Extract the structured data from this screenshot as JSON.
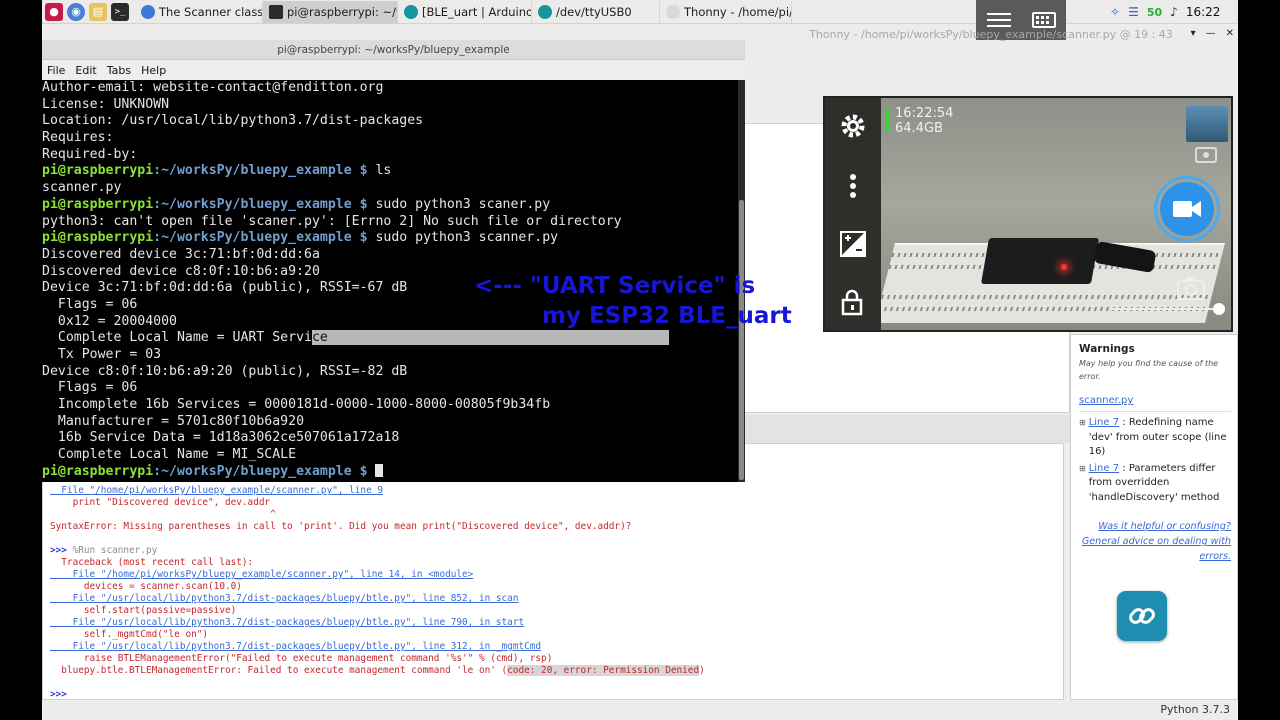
{
  "taskbar": {
    "tasks": [
      {
        "label": "The Scanner class —",
        "icon": "chromium-icon",
        "active": false
      },
      {
        "label": "pi@raspberrypi: ~/wo...",
        "icon": "terminal-icon",
        "active": true
      },
      {
        "label": "[BLE_uart | Arduino 1...",
        "icon": "arduino-icon",
        "active": false
      },
      {
        "label": "/dev/ttyUSB0",
        "icon": "arduino-icon",
        "active": false
      },
      {
        "label": "Thonny  -  /home/pi/...",
        "icon": "thonny-icon",
        "active": false
      }
    ],
    "tray": {
      "battery_level": "50",
      "clock": "16:22"
    }
  },
  "thonny": {
    "title": "Thonny  -  /home/pi/worksPy/bluepy_example/scanner.py  @  19 : 43",
    "status": "Python 3.7.3",
    "warnings": {
      "title": "Warnings",
      "subtitle": "May help you find the cause of the error.",
      "file": "scanner.py",
      "items": [
        {
          "link": "Line 7",
          "text": ": Redefining name 'dev' from outer scope (line 16)"
        },
        {
          "link": "Line 7",
          "text": ": Parameters differ from overridden 'handleDiscovery' method"
        }
      ],
      "footer_1": "Was it helpful or confusing?",
      "footer_2": "General advice on dealing with errors."
    },
    "shell": [
      {
        "type": "link",
        "text": "  File \"/home/pi/worksPy/bluepy_example/scanner.py\", line 9"
      },
      {
        "type": "err",
        "text": "    print \"Discovered device\", dev.addr"
      },
      {
        "type": "err",
        "text": "                                       ^"
      },
      {
        "type": "err",
        "text": "SyntaxError: Missing parentheses in call to 'print'. Did you mean print(\"Discovered device\", dev.addr)?"
      },
      {
        "type": "blank",
        "text": ""
      },
      {
        "type": "prompt",
        "prompt": ">>>",
        "text": " %Run scanner.py"
      },
      {
        "type": "err",
        "text": "  Traceback (most recent call last):"
      },
      {
        "type": "link",
        "text": "    File \"/home/pi/worksPy/bluepy_example/scanner.py\", line 14, in <module>"
      },
      {
        "type": "err",
        "text": "      devices = scanner.scan(10.0)"
      },
      {
        "type": "link",
        "text": "    File \"/usr/local/lib/python3.7/dist-packages/bluepy/btle.py\", line 852, in scan"
      },
      {
        "type": "err",
        "text": "      self.start(passive=passive)"
      },
      {
        "type": "link",
        "text": "    File \"/usr/local/lib/python3.7/dist-packages/bluepy/btle.py\", line 790, in start"
      },
      {
        "type": "err",
        "text": "      self._mgmtCmd(\"le on\")"
      },
      {
        "type": "link",
        "text": "    File \"/usr/local/lib/python3.7/dist-packages/bluepy/btle.py\", line 312, in _mgmtCmd"
      },
      {
        "type": "err",
        "text": "      raise BTLEManagementError(\"Failed to execute management command '%s'\" % (cmd), rsp)"
      },
      {
        "type": "errhl",
        "text": "  bluepy.btle.BTLEManagementError: Failed to execute management command 'le on' (",
        "hl": "code: 20, error: Permission Denied",
        "tail": ")"
      },
      {
        "type": "blank",
        "text": ""
      },
      {
        "type": "prompt",
        "prompt": ">>>",
        "text": ""
      }
    ]
  },
  "terminal": {
    "title": "pi@raspberrypi: ~/worksPy/bluepy_example",
    "menu": [
      "File",
      "Edit",
      "Tabs",
      "Help"
    ],
    "prompt_user": "pi@raspberrypi",
    "prompt_path": ":~/worksPy/bluepy_example $",
    "lines": [
      {
        "type": "out",
        "text": "Author-email: website-contact@fenditton.org"
      },
      {
        "type": "out",
        "text": "License: UNKNOWN"
      },
      {
        "type": "out",
        "text": "Location: /usr/local/lib/python3.7/dist-packages"
      },
      {
        "type": "out",
        "text": "Requires:"
      },
      {
        "type": "out",
        "text": "Required-by:"
      },
      {
        "type": "cmd",
        "text": " ls"
      },
      {
        "type": "out",
        "text": "scanner.py"
      },
      {
        "type": "cmd",
        "text": " sudo python3 scaner.py"
      },
      {
        "type": "out",
        "text": "python3: can't open file 'scaner.py': [Errno 2] No such file or directory"
      },
      {
        "type": "cmd",
        "text": " sudo python3 scanner.py"
      },
      {
        "type": "out",
        "text": "Discovered device 3c:71:bf:0d:dd:6a"
      },
      {
        "type": "out",
        "text": "Discovered device c8:0f:10:b6:a9:20"
      },
      {
        "type": "out",
        "text": "Device 3c:71:bf:0d:dd:6a (public), RSSI=-67 dB"
      },
      {
        "type": "out",
        "text": "  Flags = 06"
      },
      {
        "type": "out",
        "text": "  0x12 = 20004000"
      },
      {
        "type": "sel",
        "text": "  Complete Local Name = UART Servi",
        "sel": "ce",
        "rest": "                                           "
      },
      {
        "type": "out",
        "text": "  Tx Power = 03"
      },
      {
        "type": "out",
        "text": "Device c8:0f:10:b6:a9:20 (public), RSSI=-82 dB"
      },
      {
        "type": "out",
        "text": "  Flags = 06"
      },
      {
        "type": "out",
        "text": "  Incomplete 16b Services = 0000181d-0000-1000-8000-00805f9b34fb"
      },
      {
        "type": "out",
        "text": "  Manufacturer = 5701c80f10b6a920"
      },
      {
        "type": "out",
        "text": "  16b Service Data = 1d18a3062ce507061a172a18"
      },
      {
        "type": "out",
        "text": "  Complete Local Name = MI_SCALE"
      },
      {
        "type": "cmdcursor",
        "text": " "
      }
    ]
  },
  "annotation": {
    "line1": "<--- \"UART Service\" is",
    "line2": "my ESP32 BLE_uart",
    "color": "#1616d6"
  },
  "camera": {
    "time": "16:22:54",
    "storage": "64.4GB"
  }
}
